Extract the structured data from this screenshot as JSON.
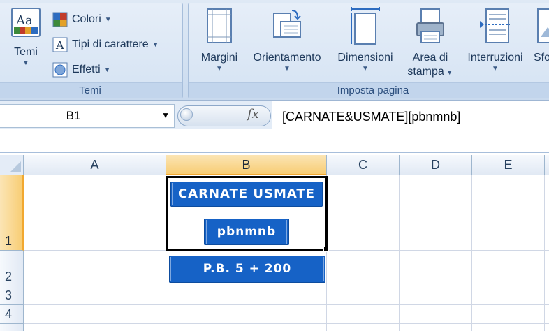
{
  "ribbon": {
    "temi_group": {
      "label": "Temi",
      "temi_button": "Temi",
      "colori": "Colori",
      "tipi_di_carattere": "Tipi di carattere",
      "effetti": "Effetti",
      "temi_icon_text": "Aa"
    },
    "imposta_group": {
      "label": "Imposta pagina",
      "margini": "Margini",
      "orientamento": "Orientamento",
      "dimensioni": "Dimensioni",
      "area_line1": "Area di",
      "area_line2": "stampa",
      "interruzioni": "Interruzioni",
      "sfondo_partial": "Sfo"
    }
  },
  "formula_bar": {
    "name_box": "B1",
    "fx": "fx",
    "formula": "[CARNATE&USMATE][pbnmnb]"
  },
  "grid": {
    "columns": [
      "A",
      "B",
      "C",
      "D",
      "E"
    ],
    "selected_column": "B",
    "rows": [
      "1",
      "2",
      "3",
      "4"
    ],
    "selected_row": "1"
  },
  "cells": {
    "b1_line1": "CARNATE USMATE",
    "b1_line2": "pbnmnb",
    "b2": "P.B. 5 + 200"
  },
  "colors": {
    "label_blue": "#1662c6",
    "selection_header": "#f8cd74",
    "ribbon_bg": "#d4e2f2"
  }
}
